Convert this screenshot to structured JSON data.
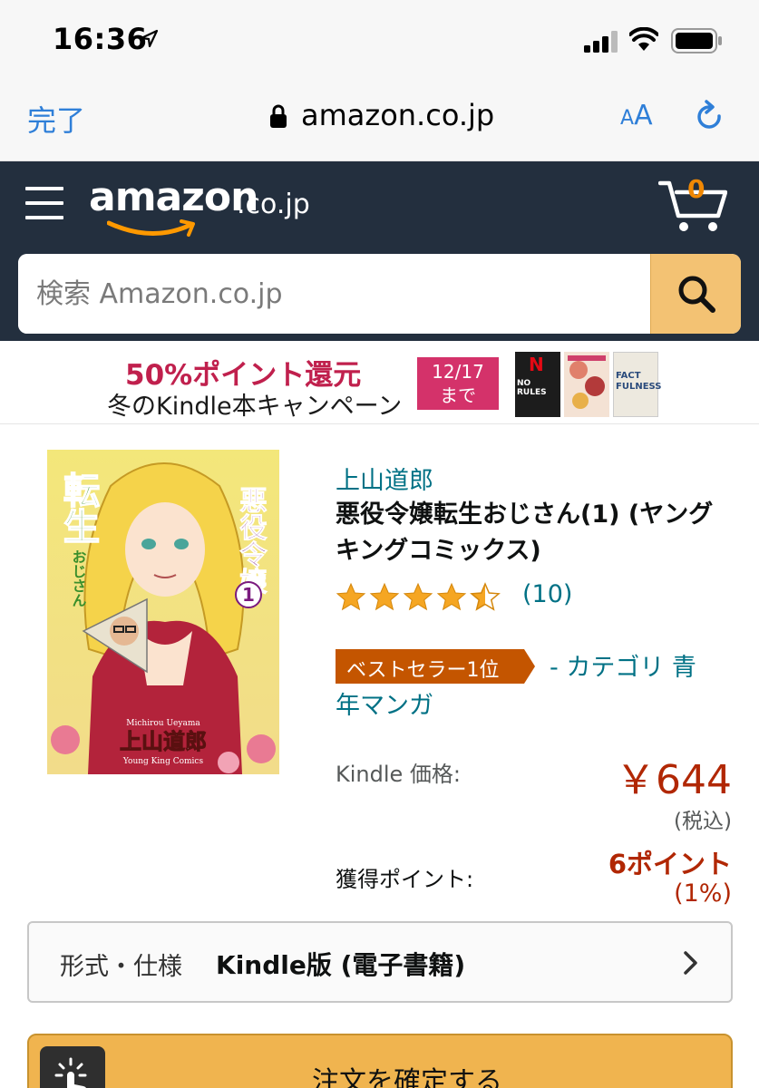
{
  "status_bar": {
    "time": "16:36"
  },
  "browser": {
    "done_label": "完了",
    "url": "amazon.co.jp",
    "aa_small": "A",
    "aa_large": "A"
  },
  "header": {
    "logo_text": "amazon",
    "logo_tld": ".co.jp",
    "cart_count": "0",
    "search_placeholder": "検索 Amazon.co.jp"
  },
  "banner": {
    "headline": "50%ポイント還元",
    "subline": "冬のKindle本キャンペーン",
    "date_line1": "12/17",
    "date_line2": "まで",
    "book1_logo": "N",
    "book1_title": "NO RULES",
    "book3_title": "FACT\nFULNESS"
  },
  "product": {
    "author": "上山道郎",
    "title": "悪役令嬢転生おじさん(1) (ヤングキングコミックス)",
    "rating_value": 4.5,
    "rating_count": "(10)",
    "bestseller_badge": "ベストセラー1位",
    "category_line1": "- カテゴリ 青",
    "category_line2": "年マンガ",
    "price_label": "Kindle 価格:",
    "price": "￥644",
    "tax_note": "(税込)",
    "points_label": "獲得ポイント:",
    "points": "6ポイント",
    "points_pct": "(1%)"
  },
  "cover": {
    "title_a": "悪役令嬢",
    "title_b": "転生",
    "title_c": "おじさん",
    "volume": "1",
    "author_en": "Michirou Ueyama",
    "author_jp": "上山道郎",
    "label": "Young King Comics"
  },
  "format": {
    "label": "形式・仕様",
    "value": "Kindle版 (電子書籍)"
  },
  "order": {
    "button_label": "注文を確定する"
  },
  "colors": {
    "amazon_header": "#232f3e",
    "search_button": "#f3c273",
    "link": "#007185",
    "price": "#b12704",
    "badge": "#c45500",
    "ios_blue": "#2f7fd8"
  }
}
